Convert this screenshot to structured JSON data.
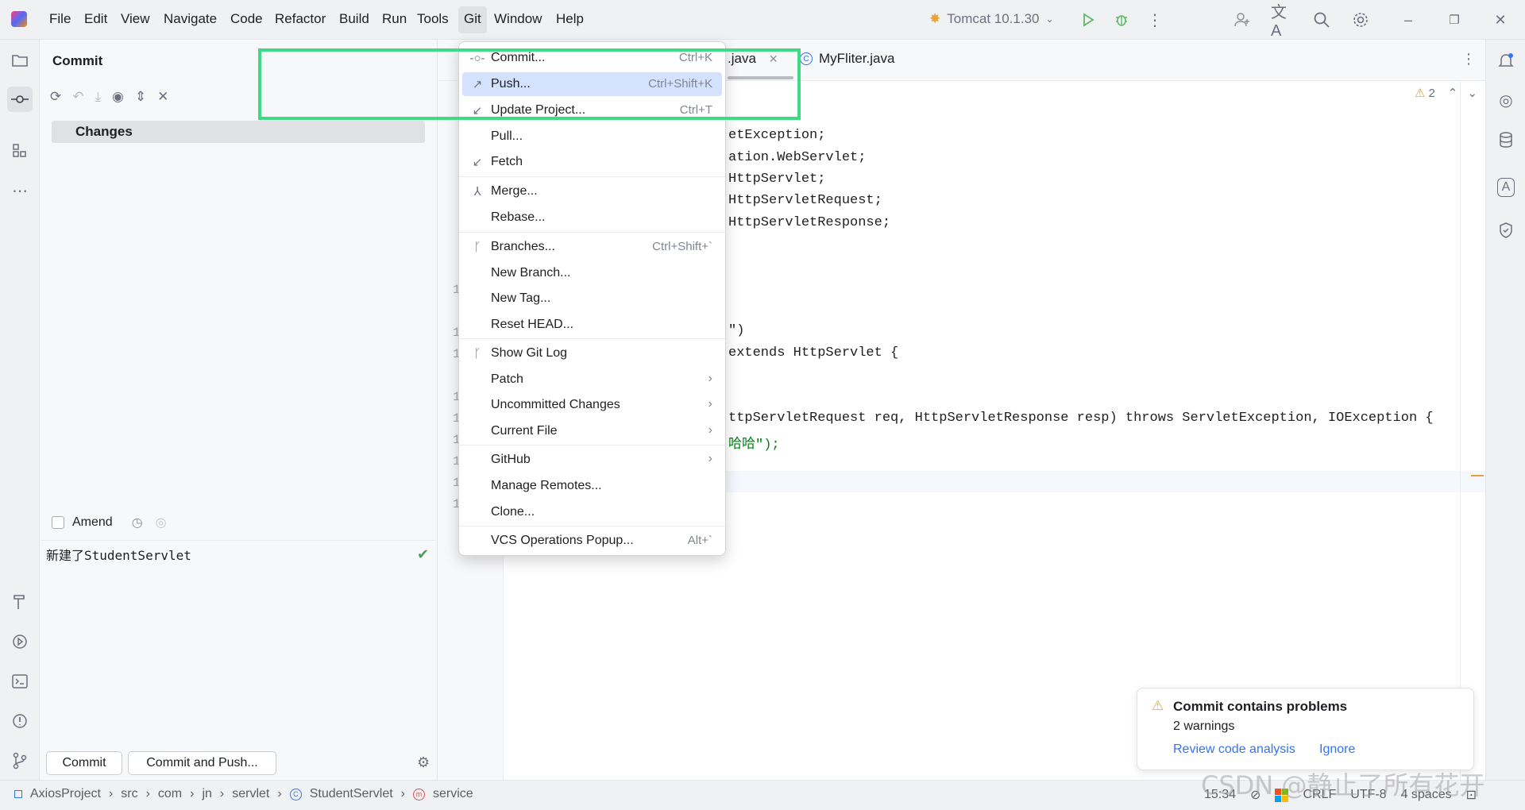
{
  "menubar": {
    "items": [
      "File",
      "Edit",
      "View",
      "Navigate",
      "Code",
      "Refactor",
      "Build",
      "Run",
      "Tools",
      "Git",
      "Window",
      "Help"
    ],
    "run_config": "Tomcat 10.1.30"
  },
  "commit_panel": {
    "title": "Commit",
    "changes_label": "Changes",
    "amend_label": "Amend",
    "message": "新建了StudentServlet",
    "commit_button": "Commit",
    "commit_push_button": "Commit and Push..."
  },
  "editor": {
    "tabs": [
      ".java",
      "MyFliter.java"
    ],
    "warning_count": "2",
    "code_lines": [
      "etException;",
      "ation.WebServlet;",
      "HttpServlet;",
      "HttpServletRequest;",
      "HttpServletResponse;",
      "\")",
      "extends HttpServlet {",
      "ttpServletRequest req, HttpServletResponse resp) throws ServletException, IOException {",
      "哈哈\");"
    ]
  },
  "git_menu": {
    "items": [
      {
        "label": "Commit...",
        "shortcut": "Ctrl+K"
      },
      {
        "label": "Push...",
        "shortcut": "Ctrl+Shift+K"
      },
      {
        "label": "Update Project...",
        "shortcut": "Ctrl+T"
      },
      {
        "label": "Pull...",
        "shortcut": ""
      },
      {
        "label": "Fetch",
        "shortcut": ""
      },
      {
        "label": "Merge...",
        "shortcut": ""
      },
      {
        "label": "Rebase...",
        "shortcut": ""
      },
      {
        "label": "Branches...",
        "shortcut": "Ctrl+Shift+`"
      },
      {
        "label": "New Branch...",
        "shortcut": ""
      },
      {
        "label": "New Tag...",
        "shortcut": ""
      },
      {
        "label": "Reset HEAD...",
        "shortcut": ""
      },
      {
        "label": "Show Git Log",
        "shortcut": ""
      },
      {
        "label": "Patch",
        "shortcut": ""
      },
      {
        "label": "Uncommitted Changes",
        "shortcut": ""
      },
      {
        "label": "Current File",
        "shortcut": ""
      },
      {
        "label": "GitHub",
        "shortcut": ""
      },
      {
        "label": "Manage Remotes...",
        "shortcut": ""
      },
      {
        "label": "Clone...",
        "shortcut": ""
      },
      {
        "label": "VCS Operations Popup...",
        "shortcut": "Alt+`"
      }
    ]
  },
  "notification": {
    "title": "Commit contains problems",
    "subtitle": "2 warnings",
    "action_review": "Review code analysis",
    "action_ignore": "Ignore"
  },
  "statusbar": {
    "breadcrumb": [
      "AxiosProject",
      "src",
      "com",
      "jn",
      "servlet",
      "StudentServlet",
      "service"
    ],
    "time": "15:34",
    "line_sep": "CRLF",
    "encoding": "UTF-8",
    "indent": "4 spaces"
  },
  "watermark": "CSDN @静止了所有花开",
  "colors": {
    "accent": "#3574f0",
    "highlight_box": "#3ddc84",
    "selected_item": "#d4e2ff",
    "warning": "#e6a23c"
  }
}
